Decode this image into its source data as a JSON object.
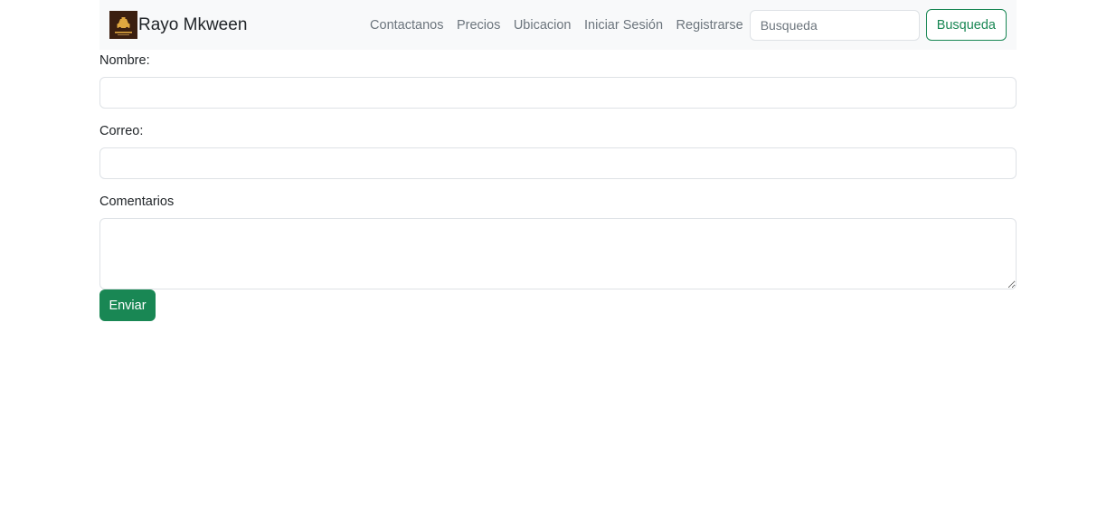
{
  "navbar": {
    "brand": {
      "name": "Rayo Mkween",
      "logo_icon": "taxi-logo-icon"
    },
    "links": [
      {
        "label": "Contactanos"
      },
      {
        "label": "Precios"
      },
      {
        "label": "Ubicacion"
      },
      {
        "label": "Iniciar Sesión"
      },
      {
        "label": "Registrarse"
      }
    ],
    "search": {
      "placeholder": "Busqueda",
      "button_label": "Busqueda"
    }
  },
  "form": {
    "name_label": "Nombre:",
    "name_value": "",
    "email_label": "Correo:",
    "email_value": "",
    "comments_label": "Comentarios",
    "comments_value": "",
    "submit_label": "Enviar"
  },
  "colors": {
    "navbar_bg": "#f8f9fa",
    "accent_green": "#198754",
    "logo_bg": "#3b1f10",
    "logo_accent": "#e0a840"
  }
}
